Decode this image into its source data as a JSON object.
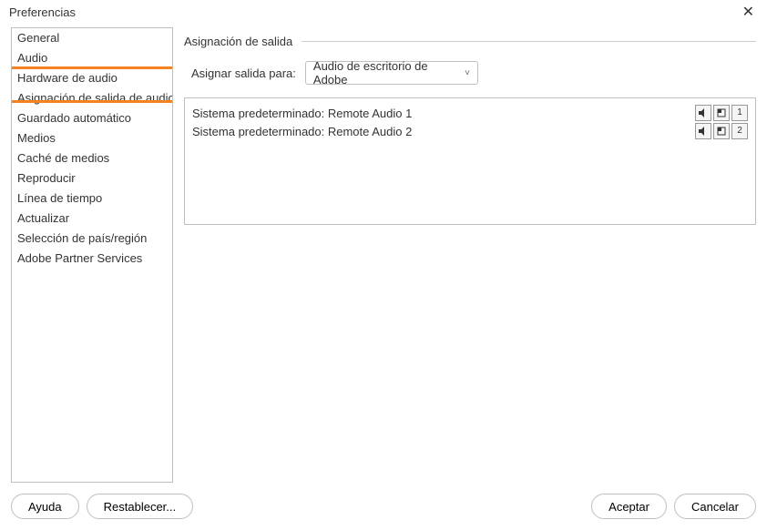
{
  "window": {
    "title": "Preferencias"
  },
  "sidebar": {
    "items": [
      "General",
      "Audio",
      "Hardware de audio",
      "Asignación de salida de audio",
      "Guardado automático",
      "Medios",
      "Caché de medios",
      "Reproducir",
      "Línea de tiempo",
      "Actualizar",
      "Selección de país/región",
      "Adobe Partner Services"
    ],
    "highlight_start_index": 2,
    "highlight_end_index": 3
  },
  "main": {
    "section_title": "Asignación de salida",
    "assign_label": "Asignar salida para:",
    "dropdown_value": "Audio de escritorio de Adobe",
    "rows": [
      {
        "text": "Sistema predeterminado: Remote Audio 1",
        "num": "1"
      },
      {
        "text": "Sistema predeterminado: Remote Audio 2",
        "num": "2"
      }
    ]
  },
  "footer": {
    "help": "Ayuda",
    "reset": "Restablecer...",
    "ok": "Aceptar",
    "cancel": "Cancelar"
  }
}
